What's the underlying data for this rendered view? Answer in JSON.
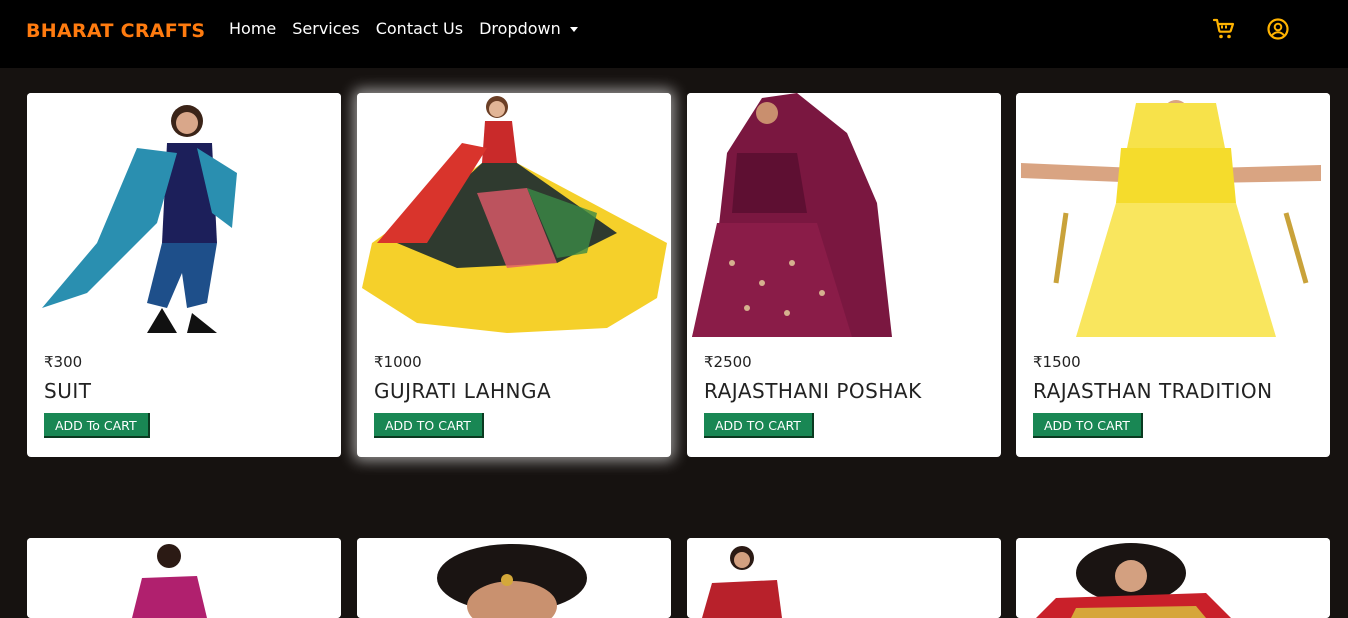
{
  "brand": "BHARAT CRAFTS",
  "nav": {
    "home": "Home",
    "services": "Services",
    "contact": "Contact Us",
    "dropdown": "Dropdown"
  },
  "icons": {
    "cart": "cart-icon",
    "user": "user-circle-icon"
  },
  "colors": {
    "brand": "#ff7b0f",
    "button": "#198754",
    "background": "#161210",
    "navbar": "#000000"
  },
  "products": [
    {
      "price": "₹300",
      "title": "SUIT",
      "button": "ADD To CART"
    },
    {
      "price": "₹1000",
      "title": "GUJRATI LAHNGA",
      "button": "ADD TO CART"
    },
    {
      "price": "₹2500",
      "title": "RAJASTHANI POSHAK",
      "button": "ADD TO CART"
    },
    {
      "price": "₹1500",
      "title": "RAJASTHAN TRADITION",
      "button": "ADD TO CART"
    }
  ]
}
